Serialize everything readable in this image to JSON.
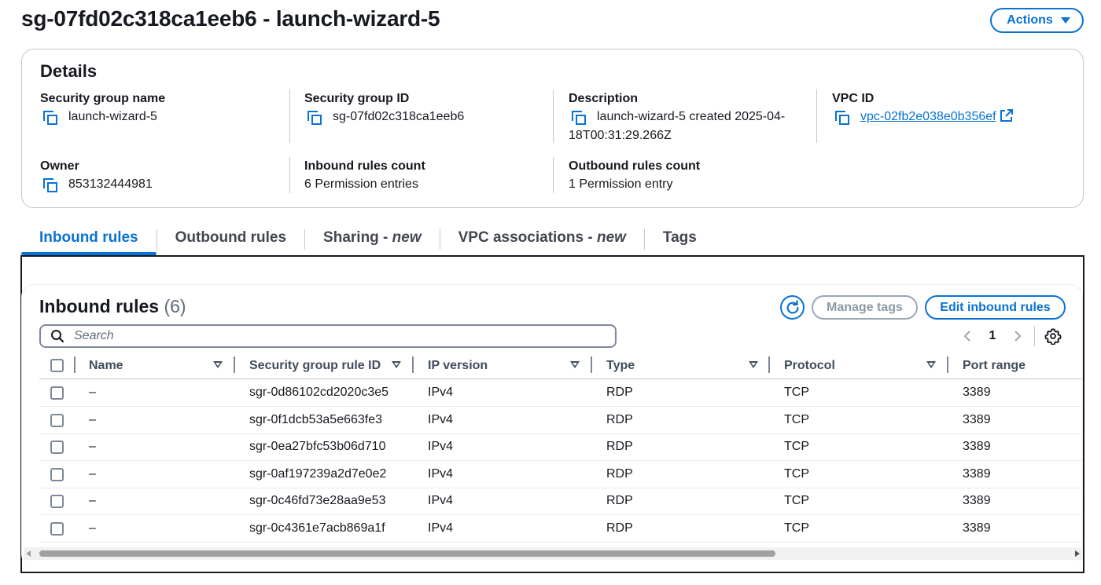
{
  "page": {
    "title": "sg-07fd02c318ca1eeb6 - launch-wizard-5",
    "actions_label": "Actions"
  },
  "details": {
    "title": "Details",
    "fields": {
      "sg_name": {
        "label": "Security group name",
        "value": "launch-wizard-5"
      },
      "sg_id": {
        "label": "Security group ID",
        "value": "sg-07fd02c318ca1eeb6"
      },
      "description": {
        "label": "Description",
        "value_line1": "launch-wizard-5 created 2025-04-",
        "value_line2": "18T00:31:29.266Z"
      },
      "vpc_id": {
        "label": "VPC ID",
        "value": "vpc-02fb2e038e0b356ef"
      },
      "owner": {
        "label": "Owner",
        "value": "853132444981"
      },
      "inbound_count": {
        "label": "Inbound rules count",
        "value": "6 Permission entries"
      },
      "outbound_count": {
        "label": "Outbound rules count",
        "value": "1 Permission entry"
      }
    }
  },
  "tabs": [
    {
      "label": "Inbound rules",
      "active": true
    },
    {
      "label": "Outbound rules",
      "active": false
    },
    {
      "label": "Sharing - ",
      "suffix": "new",
      "active": false
    },
    {
      "label": "VPC associations - ",
      "suffix": "new",
      "active": false
    },
    {
      "label": "Tags",
      "active": false
    }
  ],
  "inbound": {
    "title": "Inbound rules",
    "count": "(6)",
    "manage_tags_label": "Manage tags",
    "edit_label": "Edit inbound rules",
    "search_placeholder": "Search",
    "page_number": "1",
    "columns": [
      "Name",
      "Security group rule ID",
      "IP version",
      "Type",
      "Protocol",
      "Port range"
    ],
    "rows": [
      {
        "name": "–",
        "rule_id": "sgr-0d86102cd2020c3e5",
        "ip_version": "IPv4",
        "type": "RDP",
        "protocol": "TCP",
        "port_range": "3389"
      },
      {
        "name": "–",
        "rule_id": "sgr-0f1dcb53a5e663fe3",
        "ip_version": "IPv4",
        "type": "RDP",
        "protocol": "TCP",
        "port_range": "3389"
      },
      {
        "name": "–",
        "rule_id": "sgr-0ea27bfc53b06d710",
        "ip_version": "IPv4",
        "type": "RDP",
        "protocol": "TCP",
        "port_range": "3389"
      },
      {
        "name": "–",
        "rule_id": "sgr-0af197239a2d7e0e2",
        "ip_version": "IPv4",
        "type": "RDP",
        "protocol": "TCP",
        "port_range": "3389"
      },
      {
        "name": "–",
        "rule_id": "sgr-0c46fd73e28aa9e53",
        "ip_version": "IPv4",
        "type": "RDP",
        "protocol": "TCP",
        "port_range": "3389"
      },
      {
        "name": "–",
        "rule_id": "sgr-0c4361e7acb869a1f",
        "ip_version": "IPv4",
        "type": "RDP",
        "protocol": "TCP",
        "port_range": "3389"
      }
    ]
  },
  "colors": {
    "accent": "#0972d3",
    "text": "#16191f",
    "border": "#c6c6cd",
    "disabled": "#8d99a8"
  },
  "icons": [
    "copy-icon",
    "external-link-icon",
    "refresh-icon",
    "search-icon",
    "chevron-left-icon",
    "chevron-right-icon",
    "settings-gear-icon",
    "caret-down-icon",
    "sort-icon"
  ]
}
